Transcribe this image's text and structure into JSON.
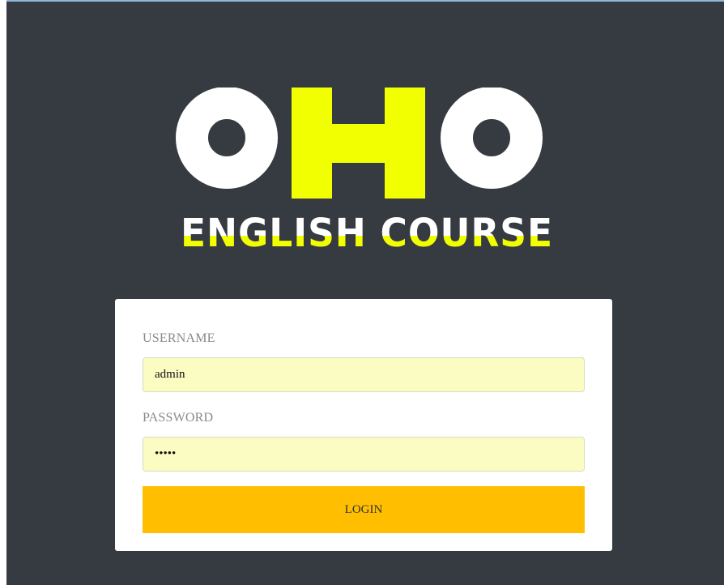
{
  "brand": {
    "logo_letters": "OHO",
    "tagline": "ENGLISH COURSE",
    "colors": {
      "ring": "#ffffff",
      "accent": "#f2ff00",
      "background": "#363a41"
    }
  },
  "login": {
    "username_label": "USERNAME",
    "username_value": "admin",
    "password_label": "PASSWORD",
    "password_value": "admin",
    "submit_label": "LOGIN",
    "colors": {
      "input_bg": "#fafcc2",
      "button_bg": "#ffbf00"
    }
  }
}
